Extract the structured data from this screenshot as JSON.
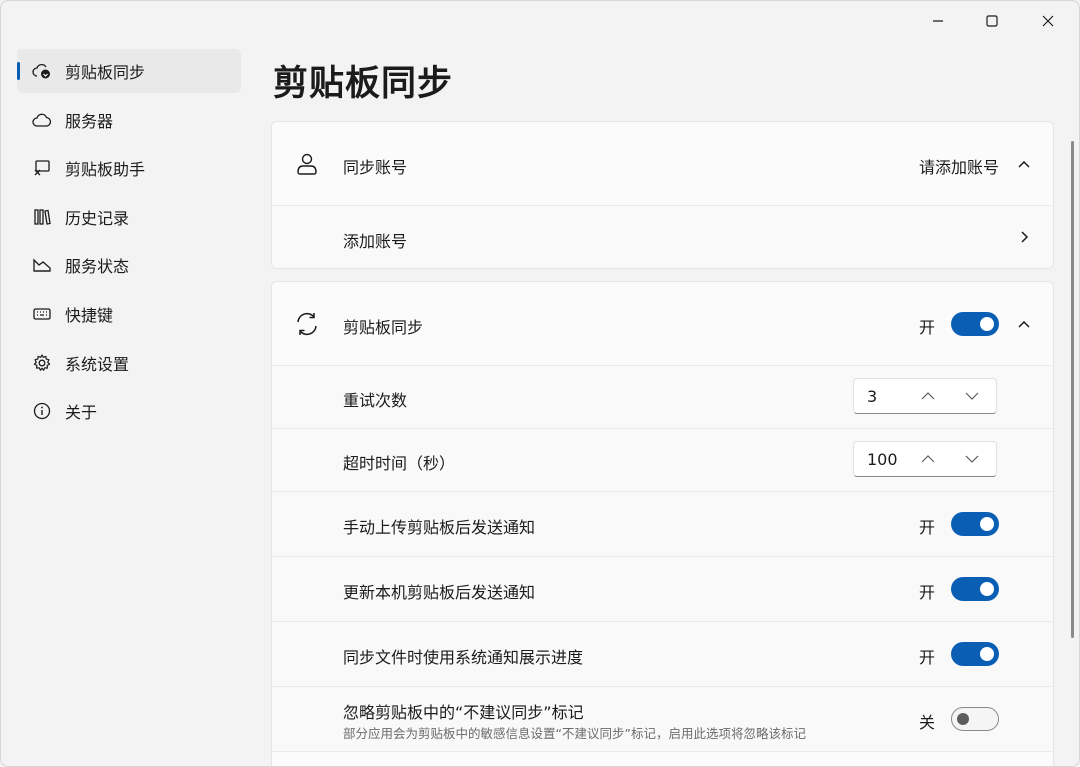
{
  "window": {
    "controls": [
      "minimize-icon",
      "maximize-icon",
      "close-icon"
    ]
  },
  "sidebar": {
    "items": [
      {
        "label": "剪贴板同步",
        "icon": "cloud-sync-icon",
        "active": true
      },
      {
        "label": "服务器",
        "icon": "cloud-icon",
        "active": false
      },
      {
        "label": "剪贴板助手",
        "icon": "screen-clipboard-icon",
        "active": false
      },
      {
        "label": "历史记录",
        "icon": "library-icon",
        "active": false
      },
      {
        "label": "服务状态",
        "icon": "area-chart-icon",
        "active": false
      },
      {
        "label": "快捷键",
        "icon": "keyboard-icon",
        "active": false
      },
      {
        "label": "系统设置",
        "icon": "gear-icon",
        "active": false
      },
      {
        "label": "关于",
        "icon": "info-icon",
        "active": false
      }
    ]
  },
  "main": {
    "title": "剪贴板同步",
    "account_card": {
      "header_label": "同步账号",
      "header_value": "请添加账号",
      "add_account_label": "添加账号"
    },
    "sync_card": {
      "header_label": "剪贴板同步",
      "header_state": "开",
      "retry": {
        "label": "重试次数",
        "value": "3"
      },
      "timeout": {
        "label": "超时时间（秒）",
        "value": "100"
      },
      "manual_upload_notify": {
        "label": "手动上传剪贴板后发送通知",
        "state": "开"
      },
      "local_update_notify": {
        "label": "更新本机剪贴板后发送通知",
        "state": "开"
      },
      "file_sync_progress": {
        "label": "同步文件时使用系统通知展示进度",
        "state": "开"
      },
      "ignore_flag": {
        "label": "忽略剪贴板中的“不建议同步”标记",
        "description": "部分应用会为剪贴板中的敏感信息设置“不建议同步”标记，启用此选项将忽略该标记",
        "state": "关"
      }
    }
  },
  "colors": {
    "accent": "#0a5fb4",
    "background": "#f3f3f3",
    "card": "#fbfbfb"
  }
}
